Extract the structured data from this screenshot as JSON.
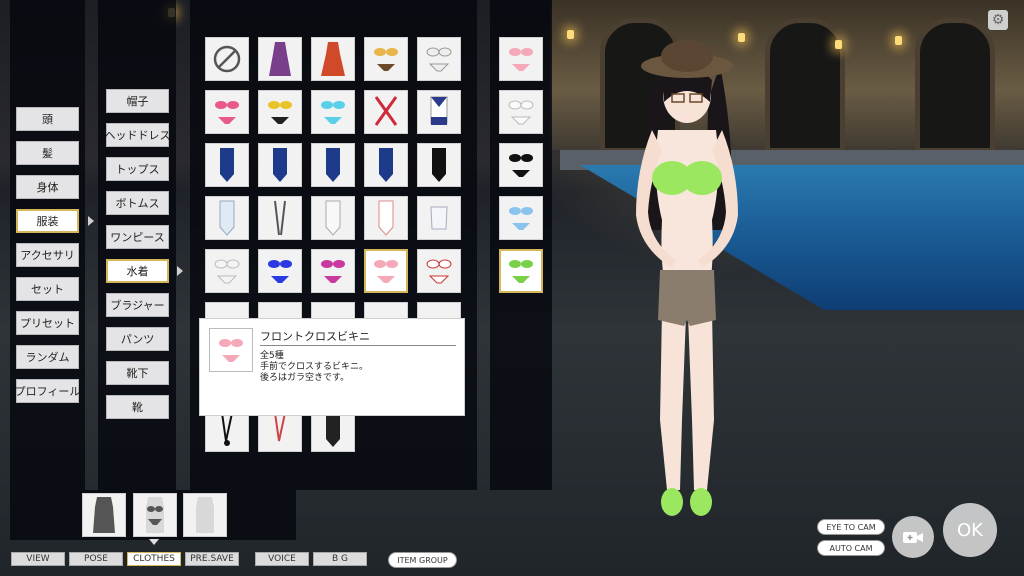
{
  "categories": [
    "頭",
    "髪",
    "身体",
    "服装",
    "アクセサリ",
    "セット",
    "プリセット",
    "ランダム",
    "プロフィール"
  ],
  "selected_category": "服装",
  "subcategories": [
    "帽子",
    "ヘッドドレス",
    "トップス",
    "ボトムス",
    "ワンピース",
    "水着",
    "ブラジャー",
    "パンツ",
    "靴下",
    "靴"
  ],
  "selected_subcategory": "水着",
  "item_tiles": {
    "row1": [
      "none",
      "dress-purple",
      "dress-red",
      "bikini-yellow",
      "bikini-white"
    ],
    "row2": [
      "bikini-pink",
      "bikini-yellow-black",
      "bikini-cyan",
      "cross-red",
      "sailor-swimsuit"
    ],
    "row3": [
      "school-swimsuit-blue",
      "school-swimsuit-blue",
      "school-swimsuit-blue",
      "school-swimsuit-blue",
      "competition-swimsuit-black"
    ],
    "row4": [
      "swimsuit-white",
      "sling-white",
      "swimsuit-white",
      "swimsuit-white-pink",
      "tube-swimsuit-white"
    ],
    "row5": [
      "bikini-white",
      "bikini-blue",
      "bikini-magenta",
      "front-cross-bikini",
      "bikini-white-red"
    ],
    "row7": [
      "sling-black",
      "sling-pink",
      "swimsuit-black"
    ]
  },
  "color_variants": [
    "pink",
    "white",
    "black",
    "light-blue",
    "green"
  ],
  "selected_variant": "green",
  "tooltip": {
    "title": "フロントクロスビキニ",
    "line1": "全5種",
    "line2": "手前でクロスするビキニ。",
    "line3": "後ろはガラ空きです。"
  },
  "clothing_states": [
    "full",
    "swimsuit",
    "nude"
  ],
  "bottom_tabs": [
    "VIEW",
    "POSE",
    "CLOTHES",
    "PRE.SAVE",
    "VOICE",
    "B G",
    "ITEM GROUP"
  ],
  "selected_tab": "CLOTHES",
  "camera": {
    "eye_to_cam": "EYE TO CAM",
    "auto_cam": "AUTO CAM"
  },
  "ok_label": "OK",
  "colors": {
    "accent": "#d6b65a",
    "bikini": "#9be860",
    "panel": "#04060c"
  }
}
